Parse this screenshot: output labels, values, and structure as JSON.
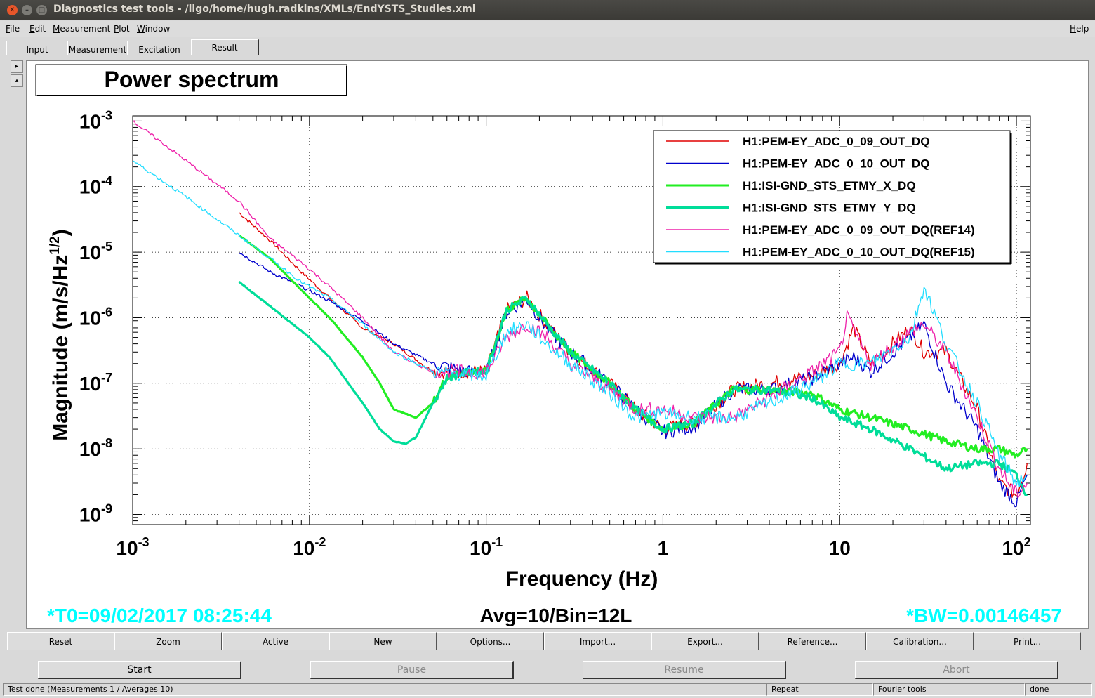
{
  "window": {
    "title": "Diagnostics test tools - /ligo/home/hugh.radkins/XMLs/EndYSTS_Studies.xml"
  },
  "menu": {
    "file": "File",
    "edit": "Edit",
    "measurement": "Measurement",
    "plot": "Plot",
    "window": "Window",
    "help": "Help"
  },
  "tabs": [
    "Input",
    "Measurement",
    "Excitation",
    "Result"
  ],
  "active_tab": "Result",
  "plot": {
    "title": "Power spectrum",
    "footer_left": "*T0=09/02/2017 08:25:44",
    "footer_center": "Avg=10/Bin=12L",
    "footer_right": "*BW=0.00146457",
    "footer_color": "#00ffff"
  },
  "chart_data": {
    "type": "line",
    "title": "Power spectrum",
    "xlabel": "Frequency (Hz)",
    "ylabel": "Magnitude (m/s/Hz^1/2)",
    "xscale": "log",
    "yscale": "log",
    "xlim": [
      0.001,
      120
    ],
    "ylim": [
      7e-10,
      0.0012
    ],
    "grid": true,
    "legend_position": "top-right",
    "x_ticks": [
      "10^-3",
      "10^-2",
      "10^-1",
      "1",
      "10",
      "10^2"
    ],
    "y_ticks": [
      "10^-9",
      "10^-8",
      "10^-7",
      "10^-6",
      "10^-5",
      "10^-4",
      "10^-3"
    ],
    "series": [
      {
        "name": "H1:PEM-EY_ADC_0_09_OUT_DQ",
        "color": "#e00000",
        "thick": false,
        "x": [
          0.004,
          0.006,
          0.009,
          0.013,
          0.02,
          0.03,
          0.05,
          0.08,
          0.1,
          0.13,
          0.17,
          0.22,
          0.3,
          0.5,
          0.7,
          1.0,
          1.5,
          2.5,
          4,
          7,
          10,
          12,
          15,
          25,
          30,
          40,
          60,
          80,
          100,
          115
        ],
        "y": [
          4e-05,
          1.5e-05,
          5e-06,
          2e-06,
          7e-07,
          4e-07,
          1.5e-07,
          1.5e-07,
          1.5e-07,
          1.3e-06,
          2e-06,
          8e-07,
          3e-07,
          1e-07,
          4e-08,
          2e-08,
          2.5e-08,
          8e-08,
          1e-07,
          1.3e-07,
          2e-07,
          7e-07,
          2e-07,
          7e-07,
          3e-07,
          3e-07,
          4e-08,
          3e-09,
          2e-09,
          6e-09
        ]
      },
      {
        "name": "H1:PEM-EY_ADC_0_10_OUT_DQ",
        "color": "#0000cc",
        "thick": false,
        "x": [
          0.004,
          0.006,
          0.009,
          0.013,
          0.02,
          0.03,
          0.05,
          0.08,
          0.1,
          0.13,
          0.17,
          0.22,
          0.3,
          0.5,
          0.7,
          1.0,
          1.5,
          2.5,
          4,
          7,
          10,
          12,
          15,
          25,
          30,
          40,
          60,
          80,
          100,
          115
        ],
        "y": [
          1e-05,
          5e-06,
          3e-06,
          1.8e-06,
          9e-07,
          4e-07,
          2e-07,
          1.5e-07,
          1.4e-07,
          1.2e-06,
          1.9e-06,
          7e-07,
          3e-07,
          1e-07,
          4e-08,
          1.8e-08,
          2.2e-08,
          8e-08,
          8e-08,
          1.2e-07,
          2e-07,
          2.5e-07,
          1.5e-07,
          5e-07,
          8e-07,
          1e-07,
          2e-08,
          3e-09,
          1.5e-09,
          4e-09
        ]
      },
      {
        "name": "H1:ISI-GND_STS_ETMY_X_DQ",
        "color": "#22ee22",
        "thick": true,
        "x": [
          0.004,
          0.006,
          0.01,
          0.013,
          0.02,
          0.025,
          0.03,
          0.04,
          0.05,
          0.06,
          0.08,
          0.1,
          0.13,
          0.17,
          0.22,
          0.3,
          0.5,
          0.7,
          1.0,
          1.5,
          2.5,
          4,
          7,
          10,
          15,
          25,
          40,
          60,
          80,
          100,
          115
        ],
        "y": [
          1.8e-05,
          8e-06,
          2e-06,
          1e-06,
          2.5e-07,
          1e-07,
          4e-08,
          3e-08,
          5e-08,
          1.3e-07,
          1.5e-07,
          1.5e-07,
          1.3e-06,
          2e-06,
          8e-07,
          3e-07,
          1e-07,
          4e-08,
          2e-08,
          2.5e-08,
          8e-08,
          8e-08,
          7e-08,
          4e-08,
          3e-08,
          2e-08,
          1.3e-08,
          1e-08,
          1e-08,
          8e-09,
          1e-08
        ]
      },
      {
        "name": "H1:ISI-GND_STS_ETMY_Y_DQ",
        "color": "#00dd99",
        "thick": true,
        "x": [
          0.004,
          0.006,
          0.01,
          0.013,
          0.02,
          0.025,
          0.03,
          0.035,
          0.04,
          0.05,
          0.06,
          0.08,
          0.1,
          0.13,
          0.17,
          0.22,
          0.3,
          0.5,
          0.7,
          1.0,
          1.5,
          2.5,
          4,
          7,
          10,
          15,
          25,
          40,
          60,
          80,
          100,
          115
        ],
        "y": [
          3.5e-06,
          1.5e-06,
          5e-07,
          2.5e-07,
          5e-08,
          2e-08,
          1.3e-08,
          1.2e-08,
          1.5e-08,
          5e-08,
          1.2e-07,
          1.5e-07,
          1.5e-07,
          1.3e-06,
          2e-06,
          8e-07,
          3e-07,
          1e-07,
          4e-08,
          2e-08,
          2.5e-08,
          8e-08,
          8e-08,
          6e-08,
          3e-08,
          2e-08,
          1e-08,
          5e-09,
          6e-09,
          6e-09,
          4e-09,
          2e-09
        ]
      },
      {
        "name": "H1:PEM-EY_ADC_0_09_OUT_DQ(REF14)",
        "color": "#ee22aa",
        "thick": false,
        "x": [
          0.001,
          0.002,
          0.004,
          0.006,
          0.009,
          0.013,
          0.02,
          0.03,
          0.04,
          0.05,
          0.07,
          0.1,
          0.13,
          0.17,
          0.22,
          0.3,
          0.5,
          0.7,
          1.0,
          1.5,
          2.5,
          4,
          7,
          10,
          11,
          15,
          25,
          30,
          40,
          60,
          80,
          100,
          115
        ],
        "y": [
          0.001,
          0.00025,
          6e-05,
          1.6e-05,
          7e-06,
          3e-06,
          1e-06,
          3e-07,
          2e-07,
          1.5e-07,
          1.5e-07,
          1.5e-07,
          5e-07,
          8e-07,
          5e-07,
          2e-07,
          8e-08,
          4e-08,
          4e-08,
          3e-08,
          3e-08,
          6e-08,
          1.5e-07,
          3e-07,
          1e-06,
          2e-07,
          6e-07,
          8e-07,
          3e-07,
          3e-08,
          5e-09,
          2e-09,
          3e-09
        ]
      },
      {
        "name": "H1:PEM-EY_ADC_0_10_OUT_DQ(REF15)",
        "color": "#22ddff",
        "thick": false,
        "x": [
          0.001,
          0.002,
          0.004,
          0.006,
          0.009,
          0.013,
          0.02,
          0.03,
          0.05,
          0.07,
          0.1,
          0.13,
          0.17,
          0.22,
          0.3,
          0.5,
          0.7,
          1.0,
          1.5,
          2.5,
          4,
          7,
          10,
          15,
          25,
          30,
          40,
          60,
          80,
          100,
          115
        ],
        "y": [
          0.00025,
          7e-05,
          1.8e-05,
          8e-06,
          3.5e-06,
          2e-06,
          8e-07,
          3e-07,
          1.5e-07,
          1.4e-07,
          1.3e-07,
          6e-07,
          8e-07,
          4e-07,
          2e-07,
          7e-08,
          3e-08,
          3.5e-08,
          3e-08,
          3e-08,
          5e-08,
          1e-07,
          2e-07,
          2e-07,
          5e-07,
          3e-06,
          4e-07,
          5e-08,
          8e-09,
          3e-09,
          4e-09
        ]
      }
    ]
  },
  "toolbar": [
    "Reset",
    "Zoom",
    "Active",
    "New",
    "Options...",
    "Import...",
    "Export...",
    "Reference...",
    "Calibration...",
    "Print..."
  ],
  "actions": {
    "start": "Start",
    "pause": "Pause",
    "resume": "Resume",
    "abort": "Abort"
  },
  "status": {
    "message": "Test done (Measurements 1 / Averages 10)",
    "mode": "Repeat",
    "tool": "Fourier tools",
    "state": "done"
  }
}
